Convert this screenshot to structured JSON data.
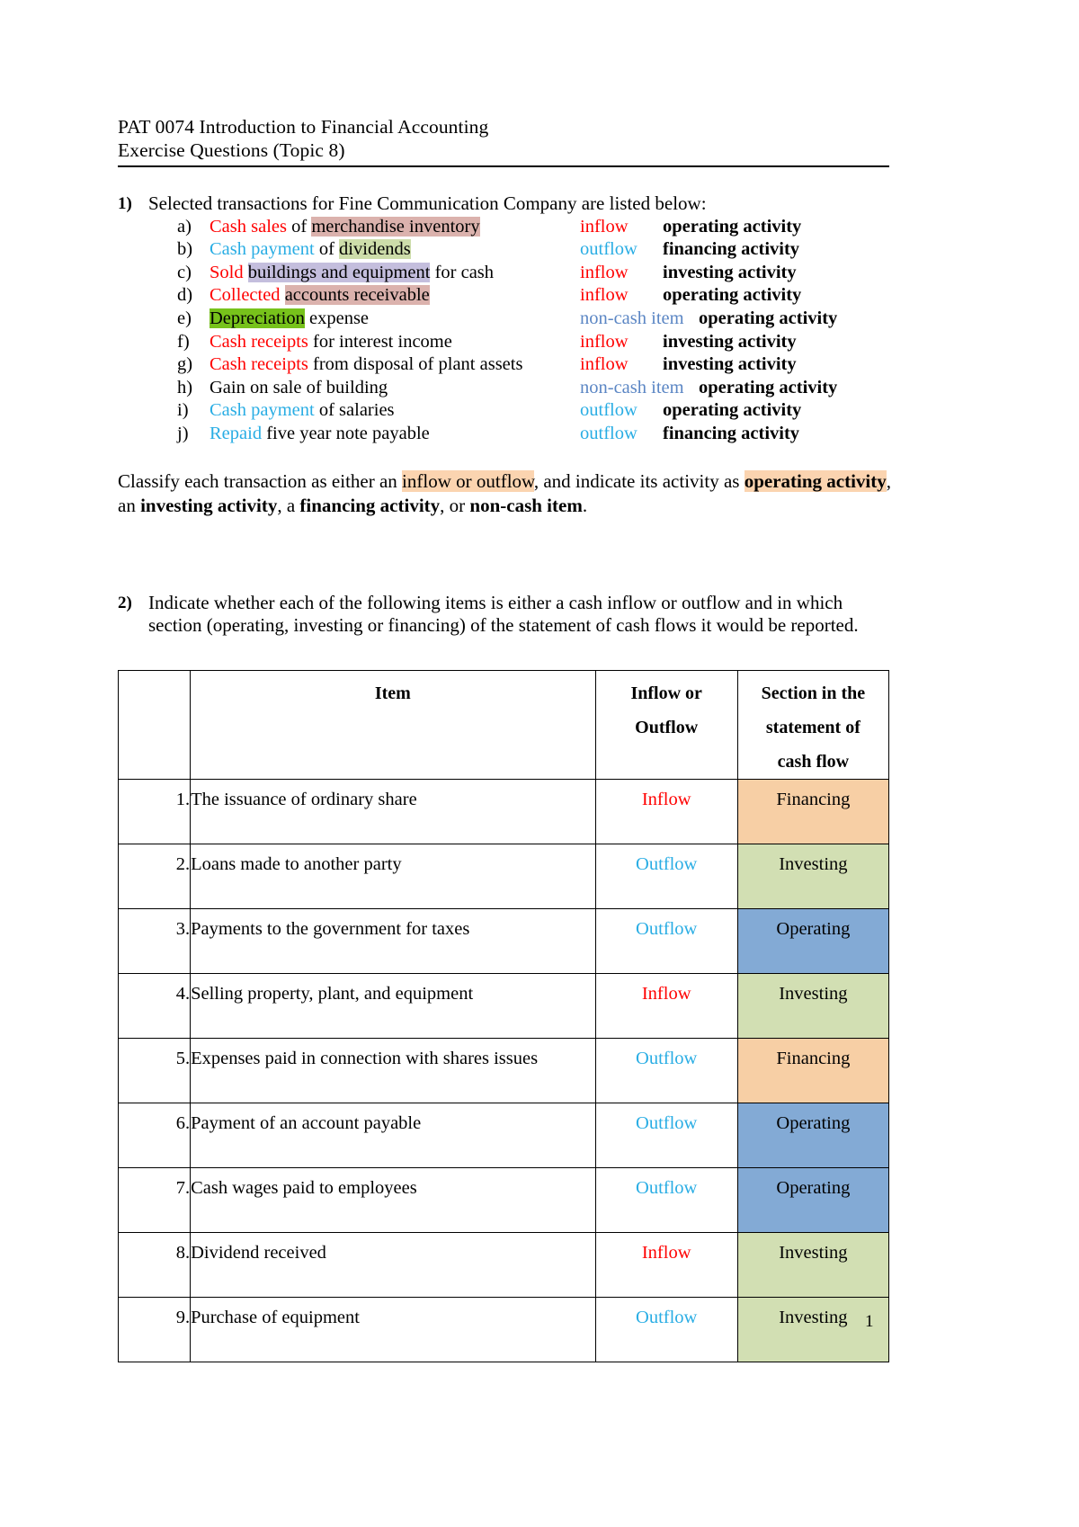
{
  "header": {
    "line1": "PAT 0074 Introduction to Financial Accounting",
    "line2": "Exercise Questions (Topic 8)"
  },
  "question1": {
    "number": "1)",
    "prompt": "Selected transactions for Fine Communication Company are listed below:",
    "items": [
      {
        "letter": "a)",
        "part1": "Cash sales",
        "part1_color": "red",
        "part2": " of ",
        "part3": "merchandise inventory",
        "part3_highlight": "pink",
        "flow": "inflow",
        "flow_color": "red",
        "activity": "operating activity"
      },
      {
        "letter": "b)",
        "part1": "Cash payment",
        "part1_color": "blue",
        "part2": " of ",
        "part3": "dividends",
        "part3_highlight": "green",
        "flow": "outflow",
        "flow_color": "blue",
        "activity": "financing activity"
      },
      {
        "letter": "c)",
        "part1": "Sold",
        "part1_color": "red",
        "part2": " ",
        "part3": "buildings and equipment",
        "part3_highlight": "purple",
        "part4": " for cash",
        "flow": "inflow",
        "flow_color": "red",
        "activity": "investing activity"
      },
      {
        "letter": "d)",
        "part1": "Collected",
        "part1_color": "red",
        "part2": " ",
        "part3": "accounts receivable",
        "part3_highlight": "pink",
        "flow": "inflow",
        "flow_color": "red",
        "activity": "operating activity"
      },
      {
        "letter": "e)",
        "part1": "Depreciation",
        "part1_color": "black",
        "part1_highlight": "lime",
        "part2": " expense",
        "flow": "non-cash item",
        "flow_color": "slate",
        "activity": "operating activity"
      },
      {
        "letter": "f)",
        "part1": "Cash receipts",
        "part1_color": "red",
        "part2": " for interest income",
        "flow": "inflow",
        "flow_color": "red",
        "activity": "investing activity"
      },
      {
        "letter": "g)",
        "part1": "Cash receipts",
        "part1_color": "red",
        "part2": " from disposal of plant assets",
        "flow": "inflow",
        "flow_color": "red",
        "activity": "investing activity"
      },
      {
        "letter": "h)",
        "part1": "Gain on sale of building",
        "part1_color": "black",
        "flow": "non-cash item",
        "flow_color": "slate",
        "activity": "operating activity"
      },
      {
        "letter": "i)",
        "part1": "Cash payment",
        "part1_color": "blue",
        "part2": " of salaries",
        "flow": "outflow",
        "flow_color": "blue",
        "activity": "operating activity"
      },
      {
        "letter": "j)",
        "part1": "Repaid",
        "part1_color": "blue",
        "part2": " five year note payable",
        "flow": "outflow",
        "flow_color": "blue",
        "activity": "financing activity"
      }
    ],
    "classify": {
      "t1": "Classify each transaction as either an ",
      "hl1": "inflow or outflow",
      "t2": ", and indicate its activity as ",
      "hl2": "operating activity",
      "t3": ", an ",
      "b1": "investing activity",
      "t4": ", a ",
      "b2": "financing activity",
      "t5": ", or ",
      "b3": "non-cash item",
      "t6": "."
    }
  },
  "question2": {
    "number": "2)",
    "prompt": "Indicate whether each of the following items is either a cash inflow or outflow and in which section (operating, investing or financing) of the statement of cash flows it would be reported.",
    "table": {
      "headers": {
        "no": "",
        "item": "Item",
        "inflow_outflow_line1": "Inflow or",
        "inflow_outflow_line2": "Outflow",
        "section_line1": "Section in the",
        "section_line2": "statement of",
        "section_line3": "cash flow"
      },
      "rows": [
        {
          "no": "1.",
          "item": "The issuance of ordinary share",
          "flow": "Inflow",
          "flow_color": "red",
          "section": "Financing",
          "section_bg": "financing"
        },
        {
          "no": "2.",
          "item": "Loans made to another party",
          "flow": "Outflow",
          "flow_color": "blue",
          "section": "Investing",
          "section_bg": "investing"
        },
        {
          "no": "3.",
          "item": "Payments to the government for taxes",
          "flow": "Outflow",
          "flow_color": "blue",
          "section": "Operating",
          "section_bg": "operating"
        },
        {
          "no": "4.",
          "item": "Selling property, plant, and equipment",
          "flow": "Inflow",
          "flow_color": "red",
          "section": "Investing",
          "section_bg": "investing"
        },
        {
          "no": "5.",
          "item": "Expenses paid in connection with shares issues",
          "flow": "Outflow",
          "flow_color": "blue",
          "section": "Financing",
          "section_bg": "financing"
        },
        {
          "no": "6.",
          "item": " Payment of an account payable",
          "flow": "Outflow",
          "flow_color": "blue",
          "section": "Operating",
          "section_bg": "operating"
        },
        {
          "no": "7.",
          "item": "Cash wages paid to employees",
          "flow": "Outflow",
          "flow_color": "blue",
          "section": "Operating",
          "section_bg": "operating"
        },
        {
          "no": "8.",
          "item": "Dividend received",
          "flow": "Inflow",
          "flow_color": "red",
          "section": "Investing",
          "section_bg": "investing"
        },
        {
          "no": "9.",
          "item": "Purchase of equipment",
          "flow": "Outflow",
          "flow_color": "blue",
          "section": "Investing",
          "section_bg": "investing"
        }
      ]
    }
  },
  "footer": {
    "page_number": "1"
  },
  "colors": {
    "red": "#ff0000",
    "blue": "#29ade4",
    "slate": "#5b86c4",
    "highlight_pink": "#dbb2ad",
    "highlight_green": "#cdddaa",
    "highlight_purple": "#c4bedd",
    "highlight_lime": "#77c21b",
    "highlight_peach": "#fbd4b0",
    "section_financing": "#f7cfa5",
    "section_investing": "#d2dfb3",
    "section_operating": "#83aad5"
  }
}
